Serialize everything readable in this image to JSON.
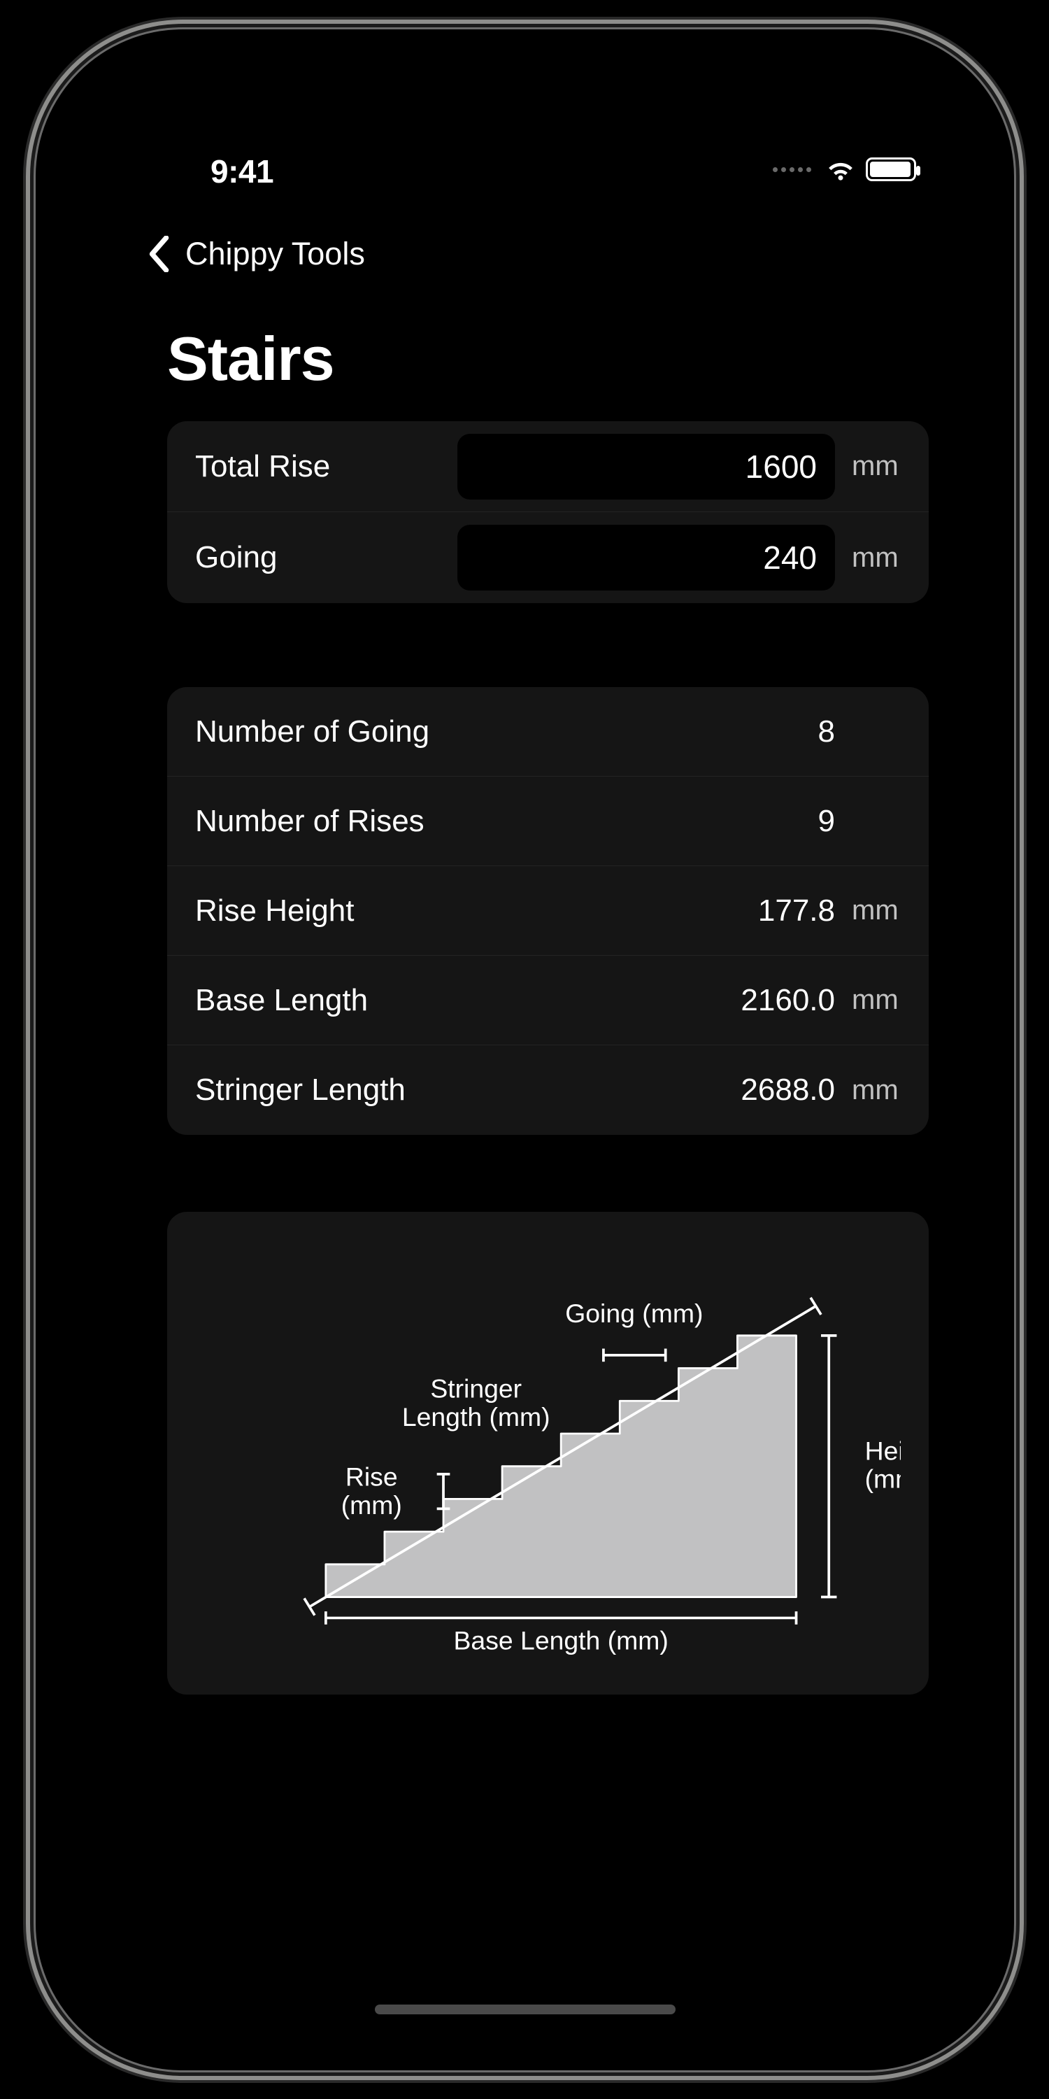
{
  "status": {
    "time": "9:41"
  },
  "nav": {
    "back_label": "Chippy Tools"
  },
  "page": {
    "title": "Stairs"
  },
  "inputs": {
    "total_rise": {
      "label": "Total Rise",
      "value": "1600",
      "unit": "mm"
    },
    "going": {
      "label": "Going",
      "value": "240",
      "unit": "mm"
    }
  },
  "results": {
    "num_going": {
      "label": "Number of Going",
      "value": "8",
      "unit": ""
    },
    "num_rises": {
      "label": "Number of Rises",
      "value": "9",
      "unit": ""
    },
    "rise_height": {
      "label": "Rise Height",
      "value": "177.8",
      "unit": "mm"
    },
    "base_length": {
      "label": "Base Length",
      "value": "2160.0",
      "unit": "mm"
    },
    "stringer_len": {
      "label": "Stringer Length",
      "value": "2688.0",
      "unit": "mm"
    }
  },
  "diagram": {
    "going": "Going (mm)",
    "stringer1": "Stringer",
    "stringer2": "Length (mm)",
    "rise1": "Rise",
    "rise2": "(mm)",
    "height1": "Height",
    "height2": "(mm)",
    "base": "Base Length (mm)"
  }
}
